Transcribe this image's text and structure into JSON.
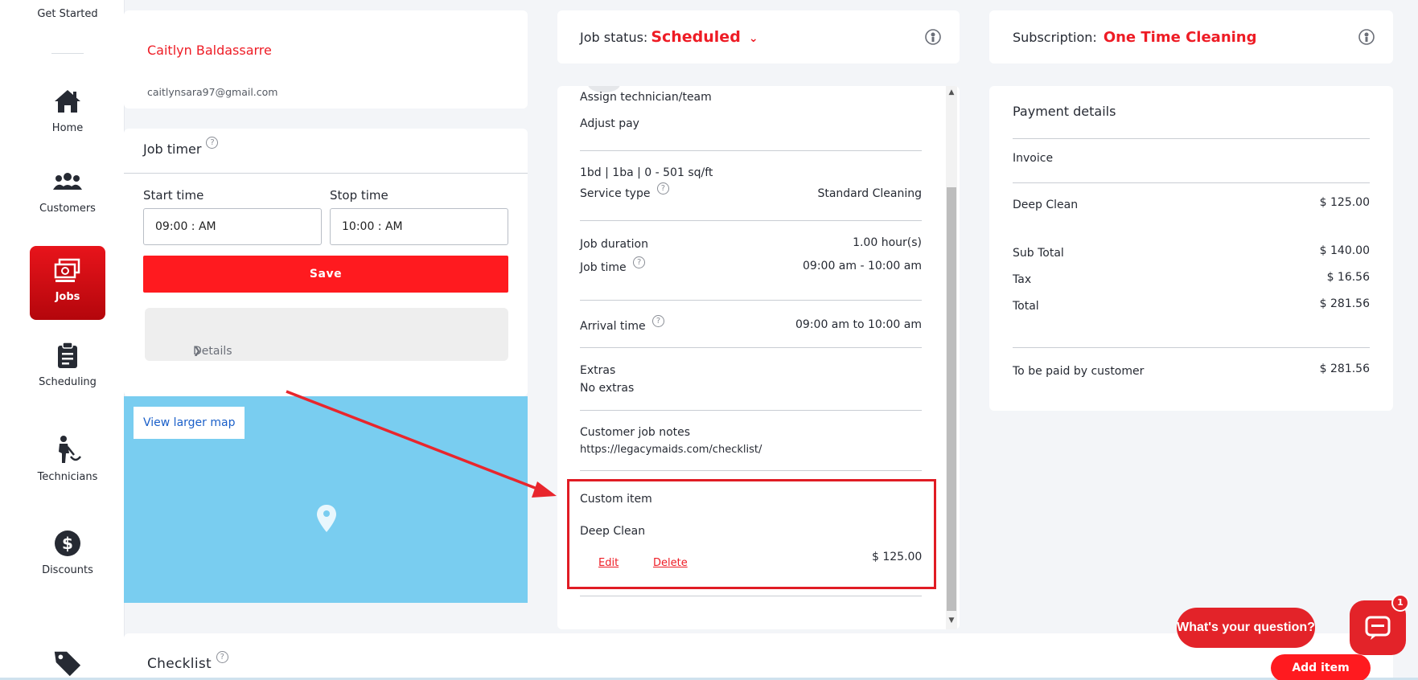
{
  "sidebar": {
    "get_started": "Get Started",
    "items": [
      {
        "label": "Home",
        "icon": "home-icon"
      },
      {
        "label": "Customers",
        "icon": "customers-icon"
      },
      {
        "label": "Jobs",
        "icon": "jobs-icon",
        "active": true
      },
      {
        "label": "Scheduling",
        "icon": "clipboard-icon"
      },
      {
        "label": "Technicians",
        "icon": "technician-icon"
      },
      {
        "label": "Discounts",
        "icon": "dollar-icon"
      }
    ]
  },
  "customer": {
    "name": "Caitlyn Baldassarre",
    "email": "caitlynsara97@gmail.com"
  },
  "job_timer": {
    "title": "Job timer",
    "help": "?",
    "start_label": "Start time",
    "stop_label": "Stop time",
    "start_value": "09:00 : AM",
    "stop_value": "10:00 : AM",
    "save_label": "Save",
    "details_label": "Details",
    "details_chevron": "❯"
  },
  "map": {
    "link_label": "View larger map"
  },
  "job_status": {
    "label": "Job status:",
    "value": "Scheduled",
    "chevron": "⌄"
  },
  "job_details": {
    "assign_link": "Assign technician/team",
    "adjust_link": "Adjust pay",
    "property": "1bd | 1ba | 0 - 501 sq/ft",
    "service_type_label": "Service type",
    "service_type_value": "Standard Cleaning",
    "duration_label": "Job duration",
    "duration_value": "1.00 hour(s)",
    "job_time_label": "Job time",
    "job_time_value": "09:00 am - 10:00 am",
    "arrival_label": "Arrival time",
    "arrival_value": "09:00 am to 10:00 am",
    "extras_label": "Extras",
    "extras_value": "No extras",
    "notes_label": "Customer job notes",
    "notes_value": "https://legacymaids.com/checklist/",
    "custom_item_label": "Custom item",
    "custom_item_name": "Deep Clean",
    "custom_item_price": "$ 125.00",
    "edit_label": "Edit",
    "delete_label": "Delete",
    "help": "?"
  },
  "subscription": {
    "label": "Subscription:",
    "value": "One Time Cleaning"
  },
  "payment": {
    "title": "Payment details",
    "invoice_label": "Invoice",
    "lines": [
      {
        "label": "Deep Clean",
        "value": "$ 125.00"
      },
      {
        "label": "Sub Total",
        "value": "$ 140.00"
      },
      {
        "label": "Tax",
        "value": "$ 16.56"
      },
      {
        "label": "Total",
        "value": "$ 281.56"
      },
      {
        "label": "To be paid by customer",
        "value": "$ 281.56"
      }
    ]
  },
  "checklist": {
    "title": "Checklist",
    "help": "?",
    "add_item": "Add item"
  },
  "chat": {
    "prompt": "What's your question?",
    "badge": "1"
  },
  "colors": {
    "accent": "#ee1c25",
    "map": "#79cdf0"
  }
}
